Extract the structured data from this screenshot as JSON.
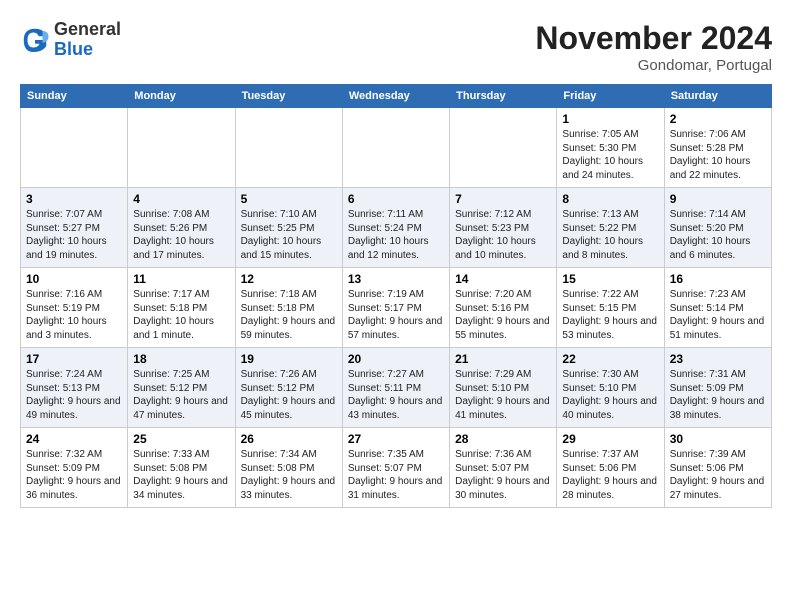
{
  "header": {
    "logo_line1": "General",
    "logo_line2": "Blue",
    "month_title": "November 2024",
    "location": "Gondomar, Portugal"
  },
  "weekdays": [
    "Sunday",
    "Monday",
    "Tuesday",
    "Wednesday",
    "Thursday",
    "Friday",
    "Saturday"
  ],
  "weeks": [
    [
      {
        "day": "",
        "info": ""
      },
      {
        "day": "",
        "info": ""
      },
      {
        "day": "",
        "info": ""
      },
      {
        "day": "",
        "info": ""
      },
      {
        "day": "",
        "info": ""
      },
      {
        "day": "1",
        "info": "Sunrise: 7:05 AM\nSunset: 5:30 PM\nDaylight: 10 hours and 24 minutes."
      },
      {
        "day": "2",
        "info": "Sunrise: 7:06 AM\nSunset: 5:28 PM\nDaylight: 10 hours and 22 minutes."
      }
    ],
    [
      {
        "day": "3",
        "info": "Sunrise: 7:07 AM\nSunset: 5:27 PM\nDaylight: 10 hours and 19 minutes."
      },
      {
        "day": "4",
        "info": "Sunrise: 7:08 AM\nSunset: 5:26 PM\nDaylight: 10 hours and 17 minutes."
      },
      {
        "day": "5",
        "info": "Sunrise: 7:10 AM\nSunset: 5:25 PM\nDaylight: 10 hours and 15 minutes."
      },
      {
        "day": "6",
        "info": "Sunrise: 7:11 AM\nSunset: 5:24 PM\nDaylight: 10 hours and 12 minutes."
      },
      {
        "day": "7",
        "info": "Sunrise: 7:12 AM\nSunset: 5:23 PM\nDaylight: 10 hours and 10 minutes."
      },
      {
        "day": "8",
        "info": "Sunrise: 7:13 AM\nSunset: 5:22 PM\nDaylight: 10 hours and 8 minutes."
      },
      {
        "day": "9",
        "info": "Sunrise: 7:14 AM\nSunset: 5:20 PM\nDaylight: 10 hours and 6 minutes."
      }
    ],
    [
      {
        "day": "10",
        "info": "Sunrise: 7:16 AM\nSunset: 5:19 PM\nDaylight: 10 hours and 3 minutes."
      },
      {
        "day": "11",
        "info": "Sunrise: 7:17 AM\nSunset: 5:18 PM\nDaylight: 10 hours and 1 minute."
      },
      {
        "day": "12",
        "info": "Sunrise: 7:18 AM\nSunset: 5:18 PM\nDaylight: 9 hours and 59 minutes."
      },
      {
        "day": "13",
        "info": "Sunrise: 7:19 AM\nSunset: 5:17 PM\nDaylight: 9 hours and 57 minutes."
      },
      {
        "day": "14",
        "info": "Sunrise: 7:20 AM\nSunset: 5:16 PM\nDaylight: 9 hours and 55 minutes."
      },
      {
        "day": "15",
        "info": "Sunrise: 7:22 AM\nSunset: 5:15 PM\nDaylight: 9 hours and 53 minutes."
      },
      {
        "day": "16",
        "info": "Sunrise: 7:23 AM\nSunset: 5:14 PM\nDaylight: 9 hours and 51 minutes."
      }
    ],
    [
      {
        "day": "17",
        "info": "Sunrise: 7:24 AM\nSunset: 5:13 PM\nDaylight: 9 hours and 49 minutes."
      },
      {
        "day": "18",
        "info": "Sunrise: 7:25 AM\nSunset: 5:12 PM\nDaylight: 9 hours and 47 minutes."
      },
      {
        "day": "19",
        "info": "Sunrise: 7:26 AM\nSunset: 5:12 PM\nDaylight: 9 hours and 45 minutes."
      },
      {
        "day": "20",
        "info": "Sunrise: 7:27 AM\nSunset: 5:11 PM\nDaylight: 9 hours and 43 minutes."
      },
      {
        "day": "21",
        "info": "Sunrise: 7:29 AM\nSunset: 5:10 PM\nDaylight: 9 hours and 41 minutes."
      },
      {
        "day": "22",
        "info": "Sunrise: 7:30 AM\nSunset: 5:10 PM\nDaylight: 9 hours and 40 minutes."
      },
      {
        "day": "23",
        "info": "Sunrise: 7:31 AM\nSunset: 5:09 PM\nDaylight: 9 hours and 38 minutes."
      }
    ],
    [
      {
        "day": "24",
        "info": "Sunrise: 7:32 AM\nSunset: 5:09 PM\nDaylight: 9 hours and 36 minutes."
      },
      {
        "day": "25",
        "info": "Sunrise: 7:33 AM\nSunset: 5:08 PM\nDaylight: 9 hours and 34 minutes."
      },
      {
        "day": "26",
        "info": "Sunrise: 7:34 AM\nSunset: 5:08 PM\nDaylight: 9 hours and 33 minutes."
      },
      {
        "day": "27",
        "info": "Sunrise: 7:35 AM\nSunset: 5:07 PM\nDaylight: 9 hours and 31 minutes."
      },
      {
        "day": "28",
        "info": "Sunrise: 7:36 AM\nSunset: 5:07 PM\nDaylight: 9 hours and 30 minutes."
      },
      {
        "day": "29",
        "info": "Sunrise: 7:37 AM\nSunset: 5:06 PM\nDaylight: 9 hours and 28 minutes."
      },
      {
        "day": "30",
        "info": "Sunrise: 7:39 AM\nSunset: 5:06 PM\nDaylight: 9 hours and 27 minutes."
      }
    ]
  ]
}
